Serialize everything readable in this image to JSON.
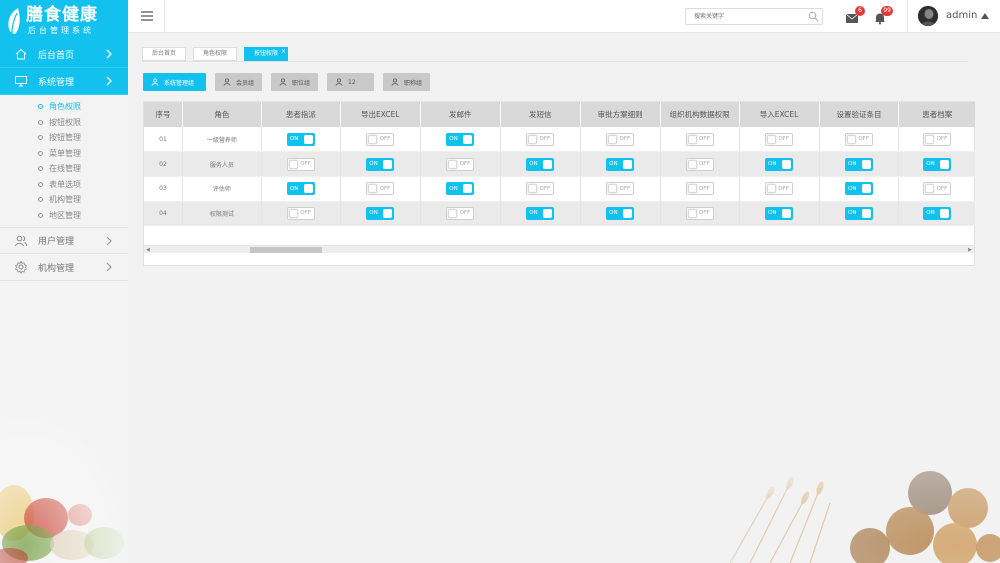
{
  "brand": {
    "title": "膳食健康",
    "subtitle": "后台管理系统"
  },
  "colors": {
    "accent": "#13c1ee",
    "badge": "#e23b3b"
  },
  "sidebar": {
    "items": [
      {
        "label": "后台首页",
        "icon": "home-icon"
      },
      {
        "label": "系统管理",
        "icon": "monitor-icon"
      },
      {
        "label": "用户管理",
        "icon": "users-icon"
      },
      {
        "label": "机构管理",
        "icon": "gear-icon"
      }
    ],
    "sub_items": [
      "角色权限",
      "按钮权限",
      "按钮管理",
      "菜单管理",
      "在线管理",
      "表单选项",
      "机构管理",
      "地区管理"
    ]
  },
  "topbar": {
    "search_placeholder": "搜索关键字",
    "mail_badge": "6",
    "bell_badge": "99",
    "username": "admin"
  },
  "tabs": [
    "后台首页",
    "角色权限",
    "按钮权限"
  ],
  "tab_close": "×",
  "groups": [
    "系统管理组",
    "会员组",
    "职位组",
    "12",
    "职称组"
  ],
  "table": {
    "headers": [
      "序号",
      "角色",
      "患者指派",
      "导出EXCEL",
      "发邮件",
      "发短信",
      "审批方案细则",
      "组织机构数据权限",
      "导入EXCEL",
      "设置验证条目",
      "患者档案"
    ],
    "on_label": "ON",
    "off_label": "OFF",
    "rows": [
      {
        "no": "01",
        "role": "一级营养师",
        "perms": [
          true,
          false,
          true,
          false,
          false,
          false,
          false,
          false,
          false
        ]
      },
      {
        "no": "02",
        "role": "服务人员",
        "perms": [
          false,
          true,
          false,
          true,
          true,
          false,
          true,
          true,
          true
        ]
      },
      {
        "no": "03",
        "role": "评估师",
        "perms": [
          true,
          false,
          true,
          false,
          false,
          false,
          false,
          true,
          false
        ]
      },
      {
        "no": "04",
        "role": "权限测试",
        "perms": [
          false,
          true,
          false,
          true,
          true,
          false,
          true,
          true,
          true
        ]
      }
    ]
  }
}
